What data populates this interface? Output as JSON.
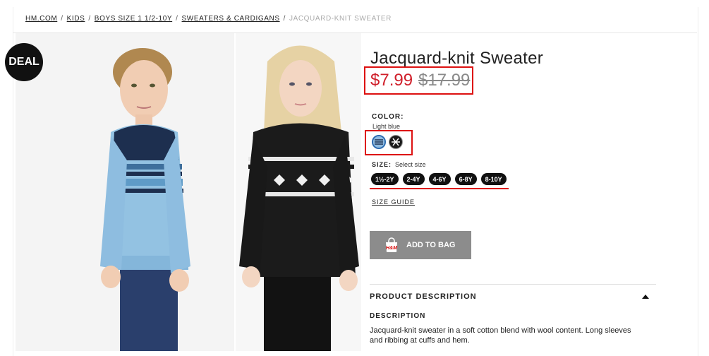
{
  "breadcrumb": {
    "items": [
      "HM.COM",
      "KIDS",
      "BOYS SIZE 1 1/2-10Y",
      "SWEATERS & CARDIGANS"
    ],
    "separator": "/",
    "current": "JACQUARD-KNIT SWEATER"
  },
  "badge": {
    "label": "DEAL"
  },
  "product": {
    "title": "Jacquard-knit Sweater",
    "price_sale": "$7.99",
    "price_original": "$17.99",
    "sale_color": "#d0202b"
  },
  "color": {
    "label": "COLOR:",
    "value": "Light blue",
    "swatches": [
      "light-blue-pattern",
      "black-pattern"
    ]
  },
  "size": {
    "label": "SIZE:",
    "hint": "Select size",
    "options": [
      "1½-2Y",
      "2-4Y",
      "4-6Y",
      "6-8Y",
      "8-10Y"
    ]
  },
  "size_guide": {
    "label": "SIZE GUIDE"
  },
  "add_to_bag": {
    "label": "ADD TO BAG",
    "icon": "hm-bag-icon"
  },
  "description": {
    "section_title": "PRODUCT DESCRIPTION",
    "subtitle": "DESCRIPTION",
    "text": "Jacquard-knit sweater in a soft cotton blend with wool content. Long sleeves and ribbing at cuffs and hem."
  },
  "annotations": {
    "highlight_color": "#d11111"
  }
}
